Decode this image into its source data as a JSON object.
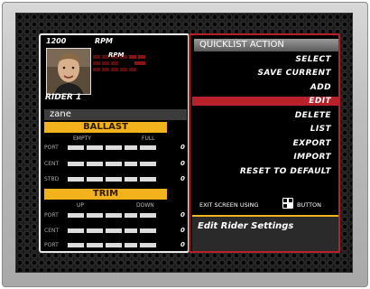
{
  "rider_panel": {
    "rpm_value": "1200",
    "rpm_label": "RPM",
    "gauge_label": "RPM",
    "rider_label": "RIDER 1",
    "rider_name": "zane",
    "ballast": {
      "title": "BALLAST",
      "col_low": "EMPTY",
      "col_high": "FULL",
      "rows": [
        {
          "label": "PORT",
          "value": "0"
        },
        {
          "label": "CENT",
          "value": "0"
        },
        {
          "label": "STBD",
          "value": "0"
        }
      ]
    },
    "trim": {
      "title": "TRIM",
      "col_low": "UP",
      "col_high": "DOWN",
      "rows": [
        {
          "label": "PORT",
          "value": "0"
        },
        {
          "label": "CENT",
          "value": "0"
        },
        {
          "label": "PORT",
          "value": "0"
        }
      ]
    }
  },
  "menu": {
    "title": "QUICKLIST ACTION",
    "items": [
      "SELECT",
      "SAVE CURRENT",
      "ADD",
      "EDIT",
      "DELETE",
      "LIST",
      "EXPORT",
      "IMPORT",
      "RESET TO DEFAULT"
    ],
    "selected": "EDIT",
    "exit_text": "EXIT SCREEN USING",
    "exit_button_label": "BUTTON",
    "description": "Edit Rider Settings"
  },
  "colors": {
    "accent_red": "#b8202a",
    "section_yellow": "#f1b21c",
    "panel_black": "#000000"
  }
}
